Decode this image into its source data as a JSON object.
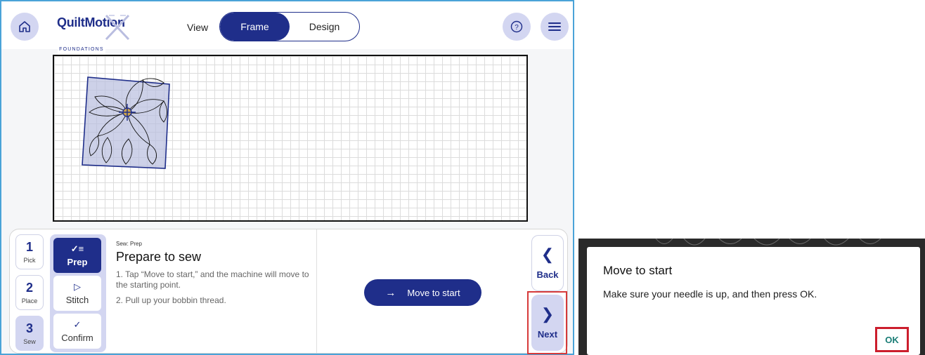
{
  "app": {
    "logo_word": "QuiltMotion",
    "logo_sub": "FOUNDATIONS",
    "view_label": "View",
    "view_options": [
      "Frame",
      "Design"
    ],
    "selected_view": "Frame",
    "icons": {
      "home": "home-icon",
      "help": "help-icon",
      "menu": "menu-icon"
    }
  },
  "steps": [
    {
      "num": "1",
      "label": "Pick"
    },
    {
      "num": "2",
      "label": "Place"
    },
    {
      "num": "3",
      "label": "Sew"
    }
  ],
  "substeps": [
    {
      "icon": "checklist-icon",
      "label": "Prep"
    },
    {
      "icon": "play-icon",
      "label": "Stitch"
    },
    {
      "icon": "check-icon",
      "label": "Confirm"
    }
  ],
  "instructions": {
    "crumb": "Sew: Prep",
    "title": "Prepare to sew",
    "step1": "1. Tap “Move to start,” and the machine will move to the starting point.",
    "step2": "2. Pull up your bobbin thread."
  },
  "move_button": "Move to start",
  "nav": {
    "back": "Back",
    "next": "Next"
  },
  "dialog": {
    "title": "Move to start",
    "message": "Make sure your needle is up, and then press OK.",
    "ok": "OK"
  },
  "colors": {
    "primary": "#1f2e8a",
    "accent_light": "#d3d6f1",
    "highlight": "#d63a3a",
    "ok_text": "#1a7d76"
  }
}
